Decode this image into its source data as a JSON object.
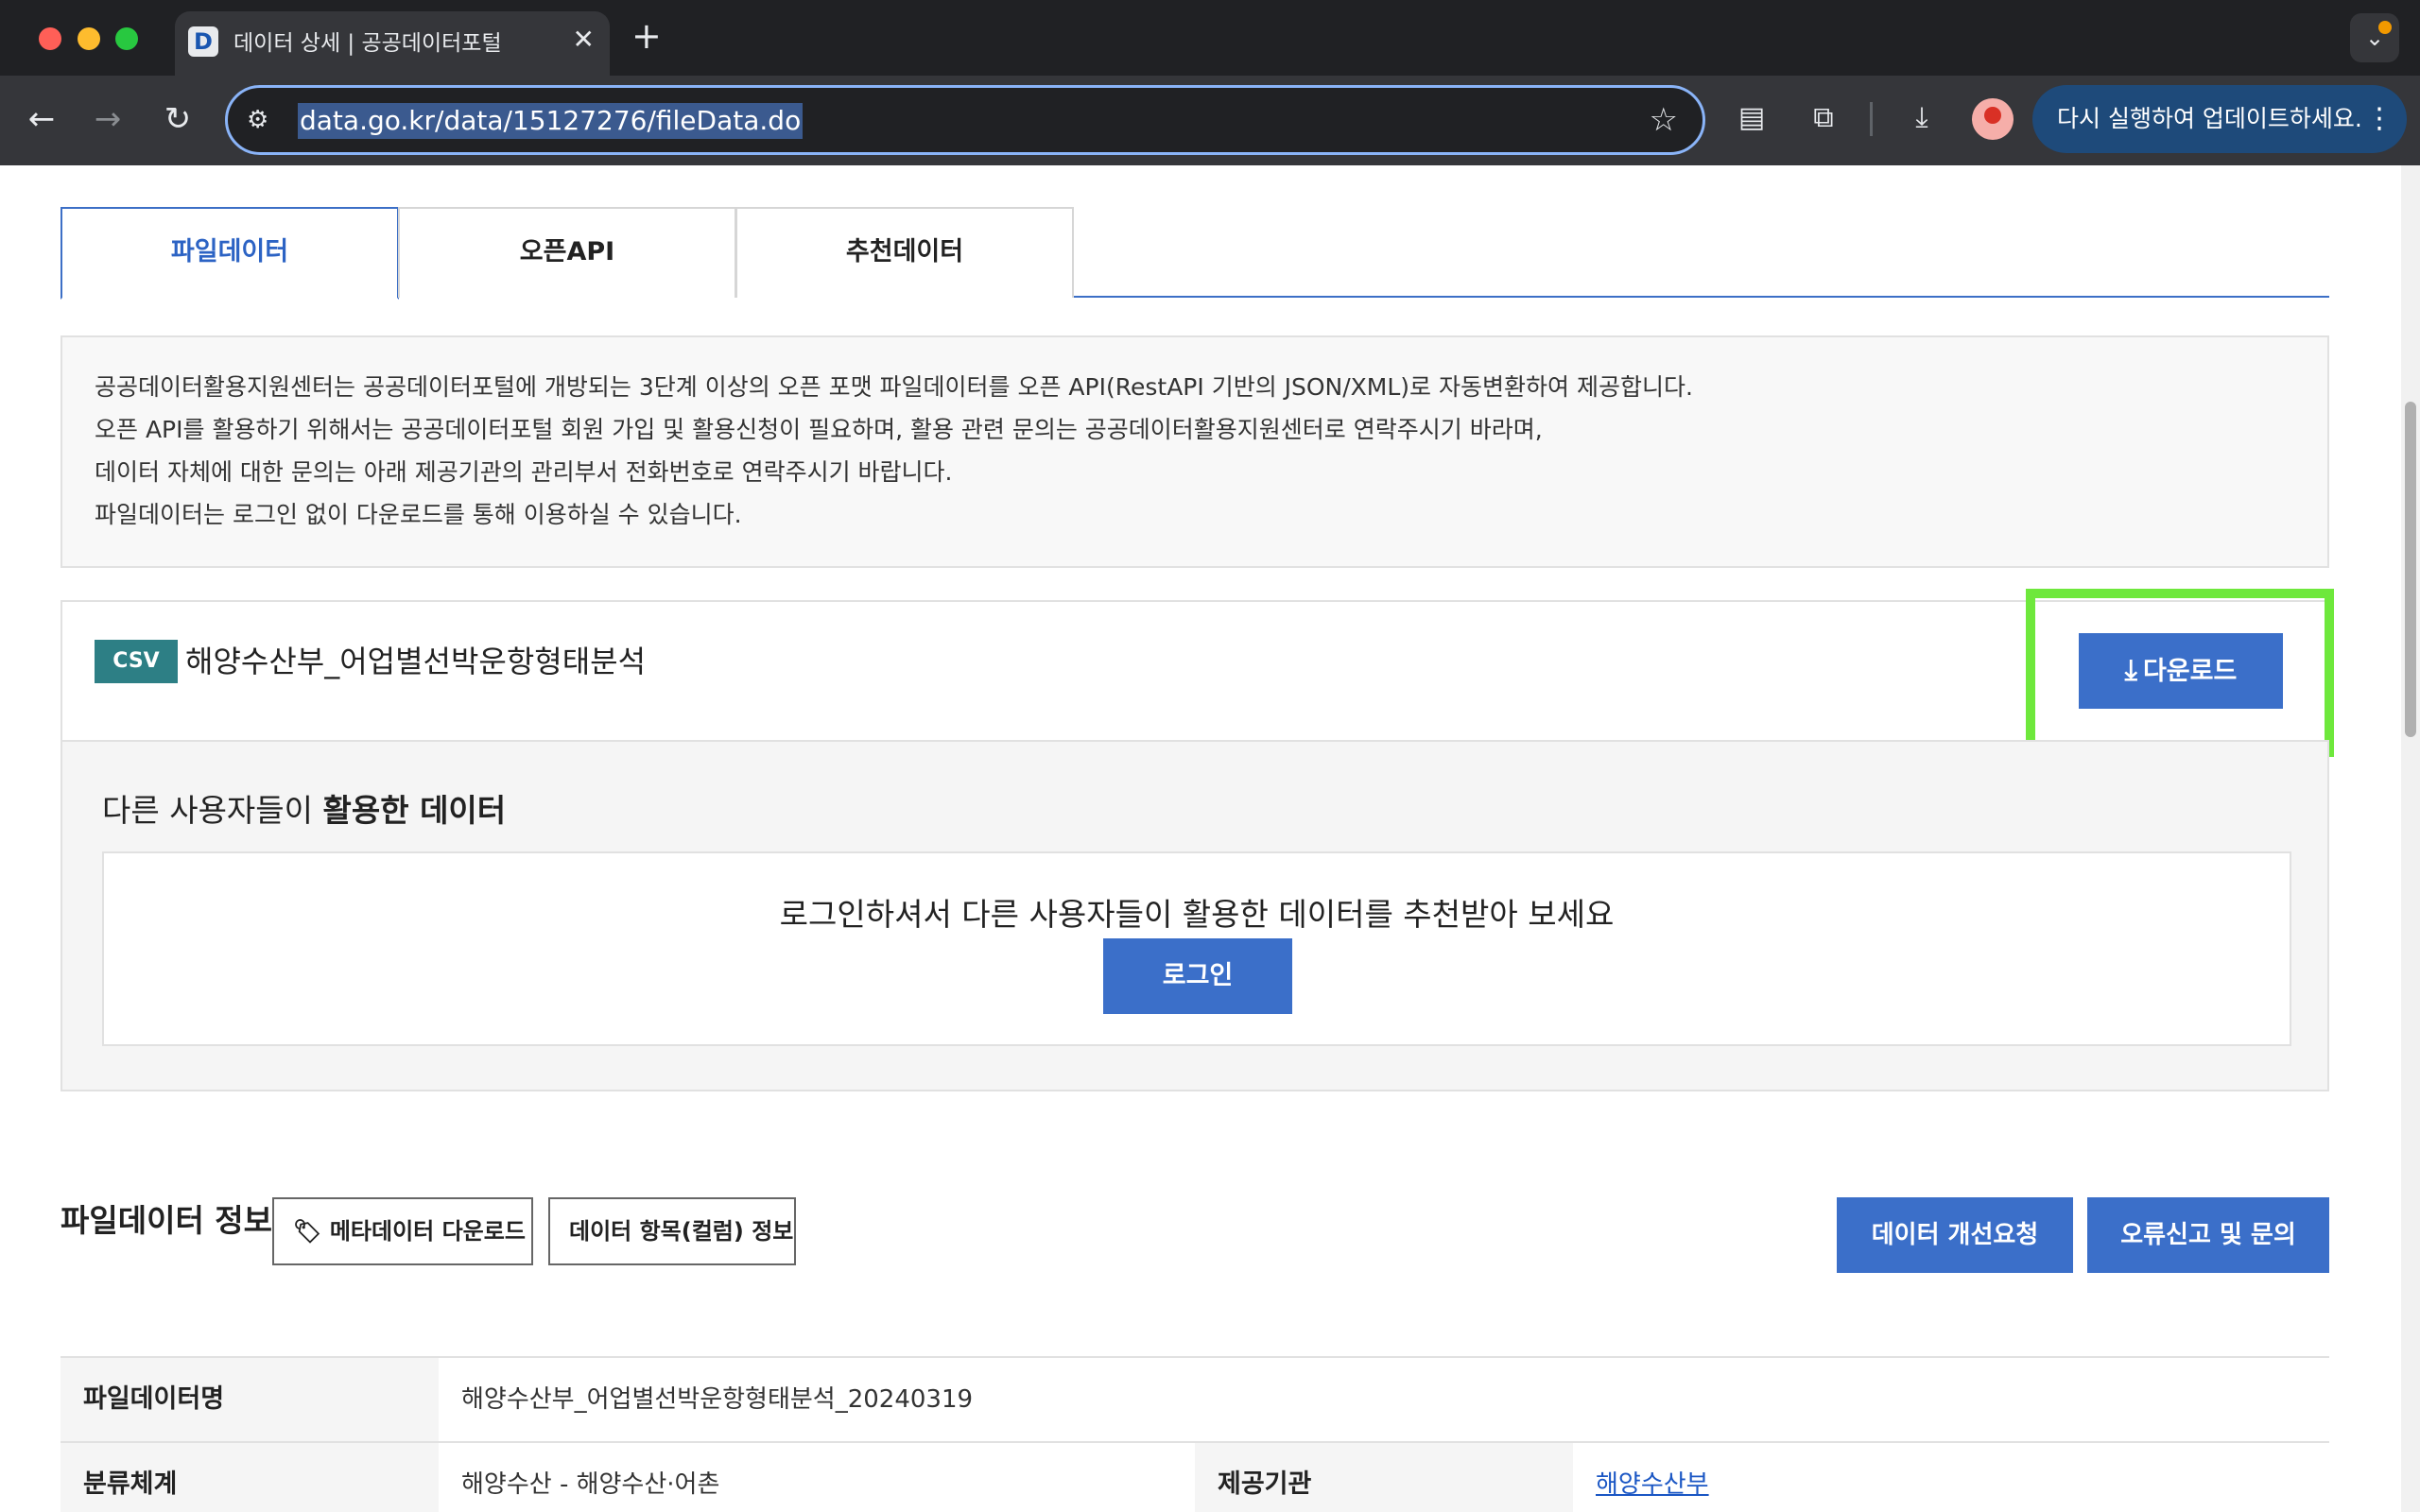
{
  "browser": {
    "tab_favicon": "D",
    "tab_title": "데이터 상세 | 공공데이터포털",
    "url": "data.go.kr/data/15127276/fileData.do",
    "update_button": "다시 실행하여 업데이트하세요."
  },
  "tabs": [
    "파일데이터",
    "오픈API",
    "추천데이터"
  ],
  "notice": [
    "공공데이터활용지원센터는 공공데이터포털에 개방되는 3단계 이상의 오픈 포맷 파일데이터를 오픈 API(RestAPI 기반의 JSON/XML)로 자동변환하여 제공합니다.",
    "오픈 API를 활용하기 위해서는 공공데이터포털 회원 가입 및 활용신청이 필요하며, 활용 관련 문의는 공공데이터활용지원센터로 연락주시기 바라며,",
    "데이터 자체에 대한 문의는 아래 제공기관의 관리부서 전화번호로 연락주시기 바랍니다.",
    "파일데이터는 로그인 없이 다운로드를 통해 이용하실 수 있습니다."
  ],
  "file": {
    "format": "CSV",
    "name": "해양수산부_어업별선박운항형태분석",
    "download_label": "다운로드"
  },
  "recommend": {
    "title_prefix": "다른 사용자들이 ",
    "title_bold": "활용한 데이터",
    "message": "로그인하셔서 다른 사용자들이 활용한 데이터를 추천받아 보세요",
    "login_label": "로그인"
  },
  "info": {
    "title": "파일데이터 정보",
    "metadata_download": "메타데이터 다운로드",
    "column_info": "데이터 항목(컬럼) 정보",
    "improve_request": "데이터 개선요청",
    "error_report": "오류신고 및 문의",
    "rows": [
      {
        "label": "파일데이터명",
        "value": "해양수산부_어업별선박운항형태분석_20240319"
      },
      {
        "label": "분류체계",
        "value": "해양수산 - 해양수산·어촌",
        "label2": "제공기관",
        "value2": "해양수산부"
      }
    ]
  },
  "colors": {
    "primary_blue": "#3b6fc9",
    "csv_badge": "#2d7f85",
    "highlight": "#6ee83c"
  }
}
